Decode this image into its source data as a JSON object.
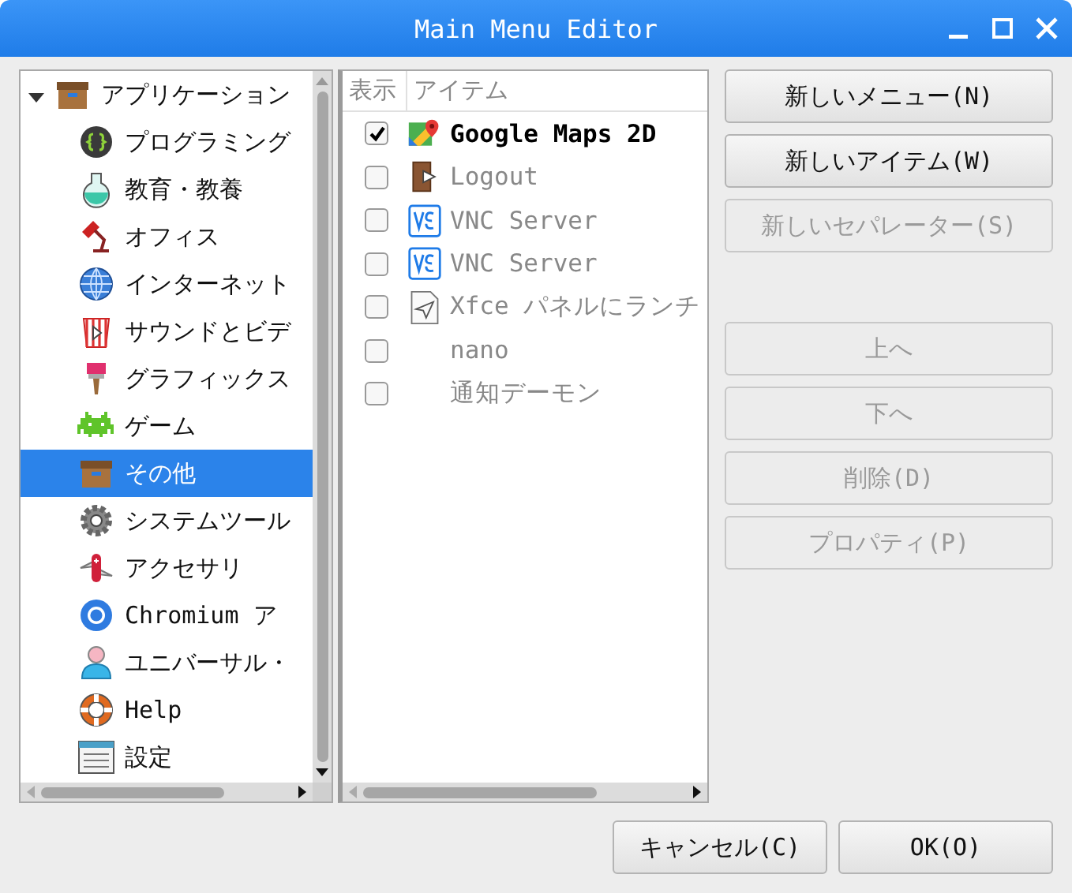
{
  "window": {
    "title": "Main Menu Editor"
  },
  "tree": {
    "label": "アプリケーション",
    "kind": "box",
    "expanded": true,
    "children": [
      {
        "label": "プログラミング",
        "kind": "code",
        "selected": false
      },
      {
        "label": "教育・教養",
        "kind": "flask",
        "selected": false
      },
      {
        "label": "オフィス",
        "kind": "lamp",
        "selected": false
      },
      {
        "label": "インターネット",
        "kind": "globe",
        "selected": false
      },
      {
        "label": "サウンドとビデ",
        "kind": "popcorn",
        "selected": false
      },
      {
        "label": "グラフィックス",
        "kind": "brush",
        "selected": false
      },
      {
        "label": "ゲーム",
        "kind": "invader",
        "selected": false
      },
      {
        "label": "その他",
        "kind": "box",
        "selected": true
      },
      {
        "label": "システムツール",
        "kind": "gear",
        "selected": false
      },
      {
        "label": "アクセサリ",
        "kind": "knife",
        "selected": false
      },
      {
        "label": "Chromium ア",
        "kind": "ring",
        "selected": false
      },
      {
        "label": "ユニバーサル・",
        "kind": "person",
        "selected": false
      },
      {
        "label": "Help",
        "kind": "buoy",
        "selected": false
      },
      {
        "label": "設定",
        "kind": "settings",
        "selected": false
      }
    ]
  },
  "list": {
    "columns": [
      "表示",
      "アイテム"
    ],
    "items": [
      {
        "name": "Google Maps 2D",
        "kind": "maps",
        "visible": true
      },
      {
        "name": "Logout",
        "kind": "door",
        "visible": false
      },
      {
        "name": "VNC Server",
        "kind": "vnc",
        "visible": false
      },
      {
        "name": "VNC Server",
        "kind": "vnc",
        "visible": false
      },
      {
        "name": "Xfce パネルにランチ",
        "kind": "launcher",
        "visible": false
      },
      {
        "name": "nano",
        "kind": "plain",
        "visible": false
      },
      {
        "name": "通知デーモン",
        "kind": "plain",
        "visible": false
      }
    ]
  },
  "buttons": [
    {
      "label": "新しいメニュー(N)",
      "disabled": false,
      "kind": "button"
    },
    {
      "label": "新しいアイテム(W)",
      "disabled": false,
      "kind": "button"
    },
    {
      "label": "新しいセパレーター(S)",
      "disabled": true,
      "kind": "button"
    },
    {
      "kind": "spacer"
    },
    {
      "label": "上へ",
      "disabled": true,
      "kind": "button"
    },
    {
      "label": "下へ",
      "disabled": true,
      "kind": "button"
    },
    {
      "label": "削除(D)",
      "disabled": true,
      "kind": "button"
    },
    {
      "label": "プロパティ(P)",
      "disabled": true,
      "kind": "button"
    }
  ],
  "dialog_buttons": [
    {
      "label": "キャンセル(C)"
    },
    {
      "label": "OK(O)"
    }
  ]
}
